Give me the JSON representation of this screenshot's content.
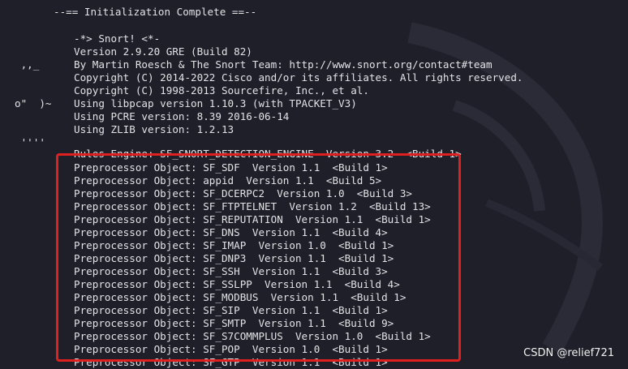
{
  "terminal": {
    "header": "--== Initialization Complete ==--",
    "logo_lines": [
      " ,,_",
      "o\"  )~",
      " ''''"
    ],
    "banner_lines": [
      "-*> Snort! <*-",
      "Version 2.9.20 GRE (Build 82)",
      "By Martin Roesch & The Snort Team: http://www.snort.org/contact#team",
      "Copyright (C) 2014-2022 Cisco and/or its affiliates. All rights reserved.",
      "Copyright (C) 1998-2013 Sourcefire, Inc., et al.",
      "Using libpcap version 1.10.3 (with TPACKET_V3)",
      "Using PCRE version: 8.39 2016-06-14",
      "Using ZLIB version: 1.2.13"
    ],
    "rules_engine_line": "Rules Engine: SF_SNORT_DETECTION_ENGINE  Version 3.2  <Build 1>",
    "preprocessor_lines": [
      "Preprocessor Object: SF_SDF  Version 1.1  <Build 1>",
      "Preprocessor Object: appid  Version 1.1  <Build 5>",
      "Preprocessor Object: SF_DCERPC2  Version 1.0  <Build 3>",
      "Preprocessor Object: SF_FTPTELNET  Version 1.2  <Build 13>",
      "Preprocessor Object: SF_REPUTATION  Version 1.1  <Build 1>",
      "Preprocessor Object: SF_DNS  Version 1.1  <Build 4>",
      "Preprocessor Object: SF_IMAP  Version 1.0  <Build 1>",
      "Preprocessor Object: SF_DNP3  Version 1.1  <Build 1>",
      "Preprocessor Object: SF_SSH  Version 1.1  <Build 3>",
      "Preprocessor Object: SF_SSLPP  Version 1.1  <Build 4>",
      "Preprocessor Object: SF_MODBUS  Version 1.1  <Build 1>",
      "Preprocessor Object: SF_SIP  Version 1.1  <Build 1>",
      "Preprocessor Object: SF_SMTP  Version 1.1  <Build 9>",
      "Preprocessor Object: SF_S7COMMPLUS  Version 1.0  <Build 1>",
      "Preprocessor Object: SF_POP  Version 1.0  <Build 1>",
      "Preprocessor Object: SF_GTP  Version 1.1  <Build 1>"
    ]
  },
  "watermark": "CSDN @relief721",
  "colors": {
    "background": "#1e1f29",
    "text": "#e3e3e6",
    "highlight_border": "#e0201f"
  }
}
